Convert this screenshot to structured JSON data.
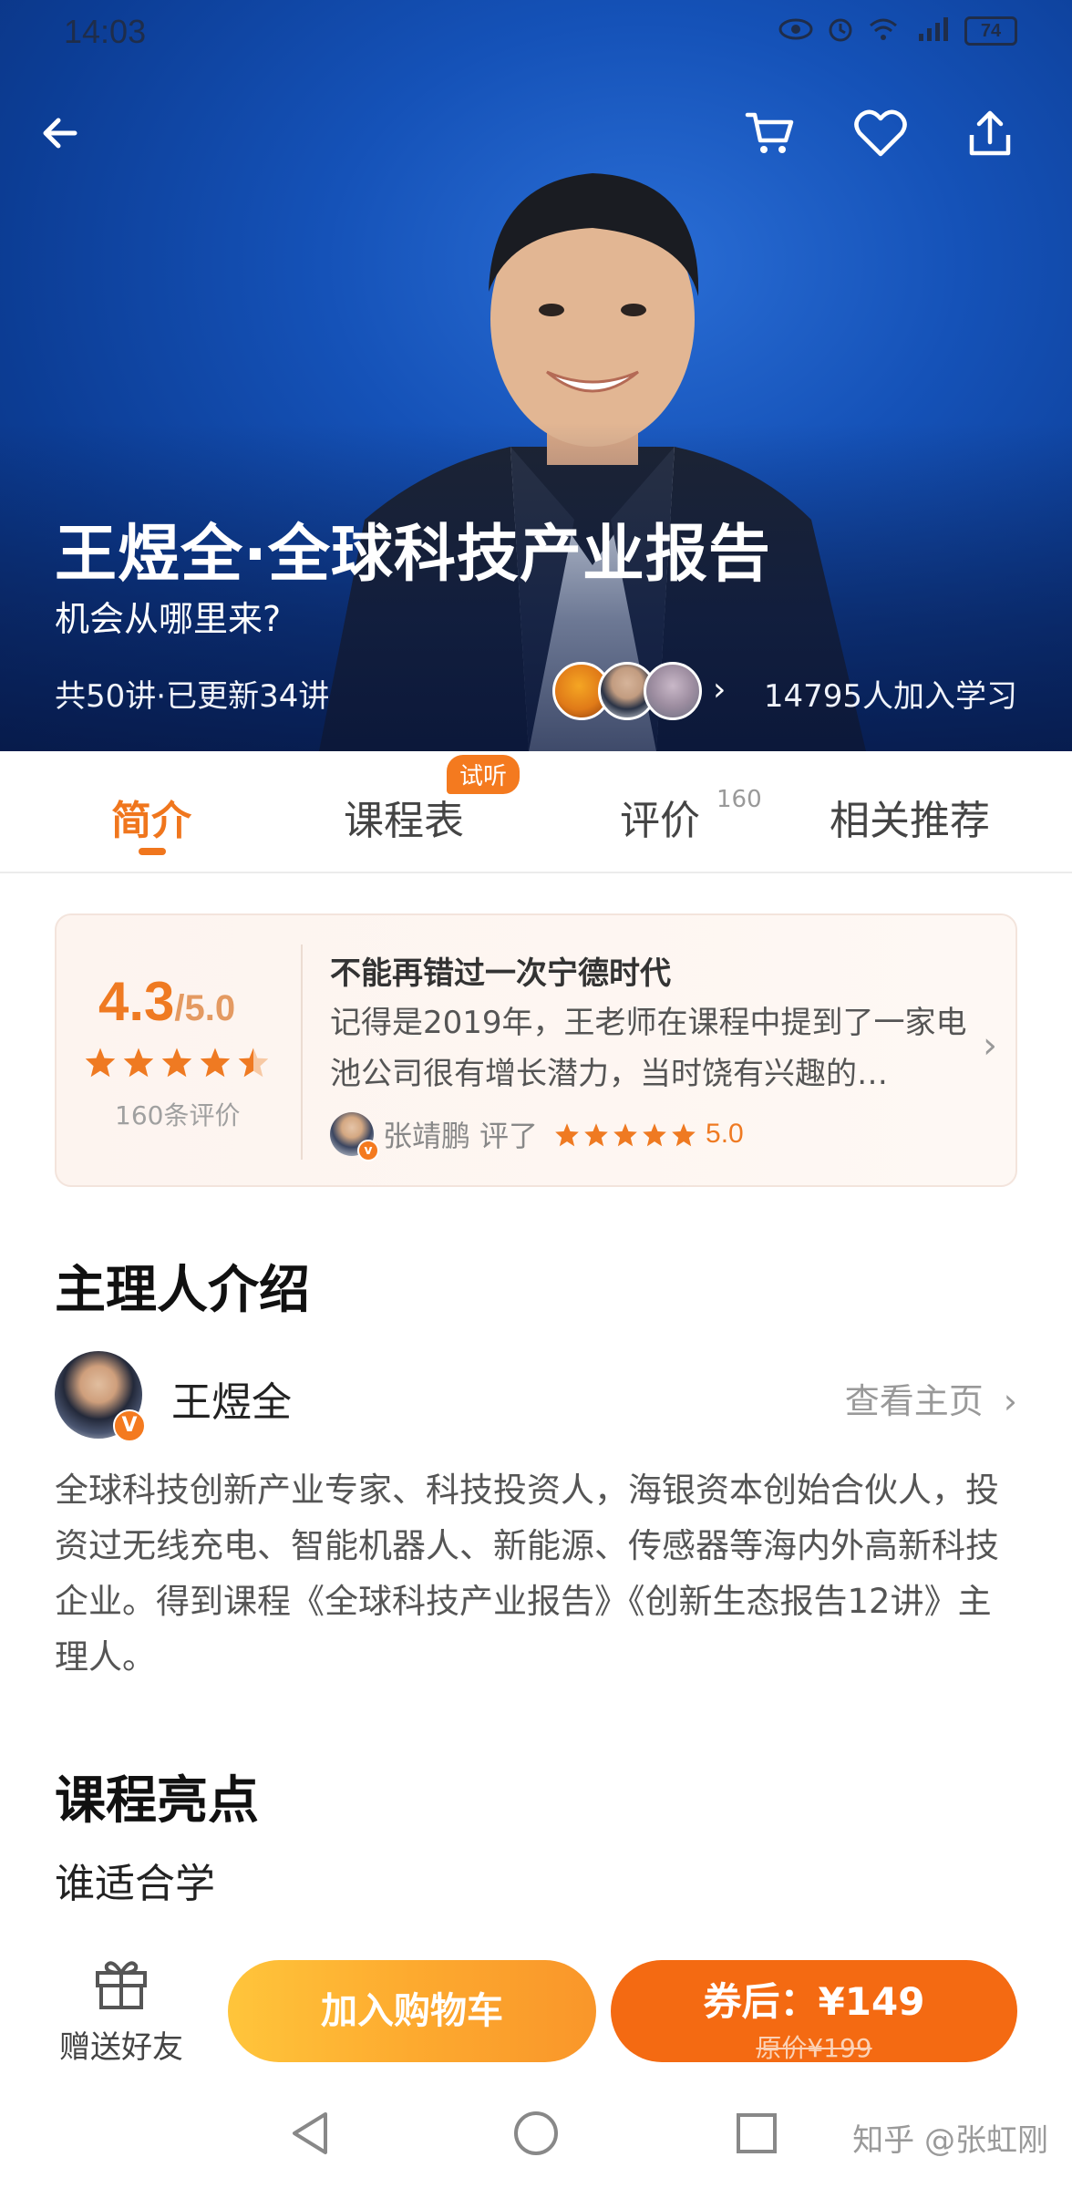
{
  "status_bar": {
    "time": "14:03",
    "battery": "74",
    "icons": [
      "eye-icon",
      "alarm-icon",
      "wifi-icon",
      "5g-signal-icon",
      "battery-icon"
    ]
  },
  "top_bar": {
    "icons": [
      "back-arrow-icon",
      "cart-icon",
      "heart-icon",
      "share-icon"
    ]
  },
  "hero": {
    "title": "王煜全·全球科技产业报告",
    "subtitle": "机会从哪里来?",
    "lecture_info": "共50讲·已更新34讲",
    "learners": "14795人加入学习"
  },
  "tabs": [
    {
      "label": "简介",
      "active": true
    },
    {
      "label": "课程表",
      "badge": "试听"
    },
    {
      "label": "评价",
      "count": "160"
    },
    {
      "label": "相关推荐"
    }
  ],
  "rating": {
    "score": "4.3",
    "scale": "/5.0",
    "stars": 4.5,
    "count_label": "160条评价",
    "review": {
      "title": "不能再错过一次宁德时代",
      "body": "记得是2019年，王老师在课程中提到了一家电池公司很有增长潜力，当时饶有兴趣的…",
      "user": "张靖鹏",
      "action": "评了",
      "user_stars": 5,
      "user_score": "5.0"
    }
  },
  "host": {
    "section_title": "主理人介绍",
    "name": "王煜全",
    "link": "查看主页",
    "badge": "V",
    "description": "全球科技创新产业专家、科技投资人，海银资本创始合伙人，投资过无线充电、智能机器人、新能源、传感器等海内外高新科技企业。得到课程《全球科技产业报告》《创新生态报告12讲》主理人。"
  },
  "highlights": {
    "section_title": "课程亮点",
    "sub_title": "谁适合学"
  },
  "actions": {
    "gift_label": "赠送好友",
    "cart_label": "加入购物车",
    "buy_label": "券后：¥149",
    "original_price": "原价¥199"
  },
  "watermark": "知乎 @张虹刚",
  "colors": {
    "accent": "#f0761d",
    "buy_button": "#f46a12",
    "hero_blue": "#1552b8"
  }
}
